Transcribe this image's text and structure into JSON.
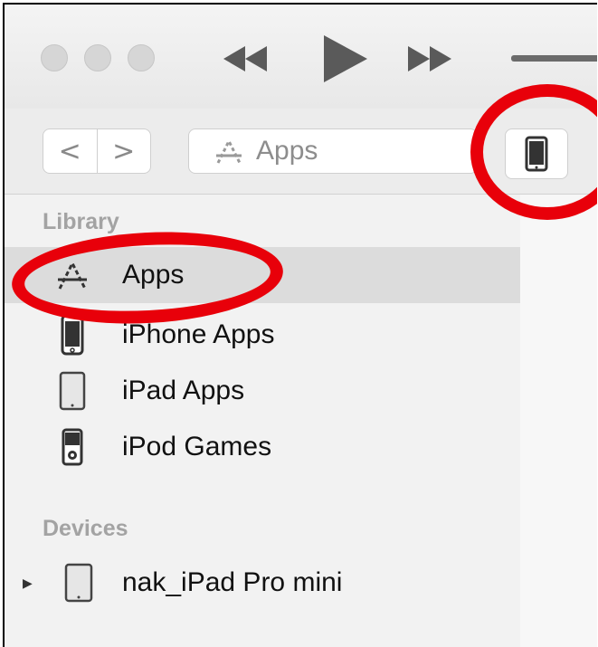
{
  "toolbar": {
    "rewind_icon": "rewind-icon",
    "play_icon": "play-icon",
    "forward_icon": "fast-forward-icon"
  },
  "nav": {
    "back": "<",
    "forward": ">",
    "media_kind": "Apps"
  },
  "sidebar": {
    "library_header": "Library",
    "items": [
      {
        "label": "Apps",
        "icon": "app-store-icon",
        "selected": true
      },
      {
        "label": "iPhone Apps",
        "icon": "iphone-icon",
        "selected": false
      },
      {
        "label": "iPad Apps",
        "icon": "ipad-icon",
        "selected": false
      },
      {
        "label": "iPod Games",
        "icon": "ipod-icon",
        "selected": false
      }
    ],
    "devices_header": "Devices",
    "devices": [
      {
        "label": "nak_iPad Pro mini",
        "icon": "ipad-icon"
      }
    ]
  },
  "annotation_color": "#e8000a"
}
